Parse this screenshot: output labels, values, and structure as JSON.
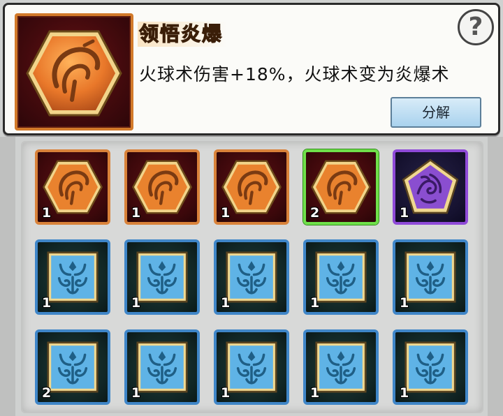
{
  "info": {
    "title": "领悟炎爆",
    "description": "火球术伤害+18%，火球术变为炎爆术",
    "help_label": "?",
    "decompose_label": "分解",
    "icon": "fireball-sigil-icon"
  },
  "inventory": {
    "rows": [
      [
        {
          "kind": "orange",
          "icon": "fireball-sigil-icon",
          "count": "1"
        },
        {
          "kind": "orange",
          "icon": "fireball-sigil-icon",
          "count": "1"
        },
        {
          "kind": "orange",
          "icon": "fireball-sigil-icon",
          "count": "1"
        },
        {
          "kind": "orange",
          "icon": "fireball-sigil-icon",
          "count": "2",
          "selected": true
        },
        {
          "kind": "purple",
          "icon": "shadow-pentagon-icon",
          "count": "1"
        }
      ],
      [
        {
          "kind": "blue",
          "icon": "blue-mask-icon",
          "count": "1"
        },
        {
          "kind": "blue",
          "icon": "blue-mask-icon",
          "count": "1"
        },
        {
          "kind": "blue",
          "icon": "blue-mask-icon",
          "count": "1"
        },
        {
          "kind": "blue",
          "icon": "blue-mask-icon",
          "count": "1"
        },
        {
          "kind": "blue",
          "icon": "blue-mask-icon",
          "count": "1"
        }
      ],
      [
        {
          "kind": "blue",
          "icon": "blue-mask-icon",
          "count": "2"
        },
        {
          "kind": "blue",
          "icon": "blue-mask-icon",
          "count": "1"
        },
        {
          "kind": "blue",
          "icon": "blue-mask-icon",
          "count": "1"
        },
        {
          "kind": "blue",
          "icon": "blue-mask-icon",
          "count": "1"
        },
        {
          "kind": "blue",
          "icon": "blue-mask-icon",
          "count": "1"
        }
      ]
    ]
  },
  "colors": {
    "orange_border": "#d9823a",
    "purple_border": "#8f4ad8",
    "blue_border": "#3f86c8",
    "selected_border": "#6fe04a",
    "title_color": "#ff8a1a"
  }
}
